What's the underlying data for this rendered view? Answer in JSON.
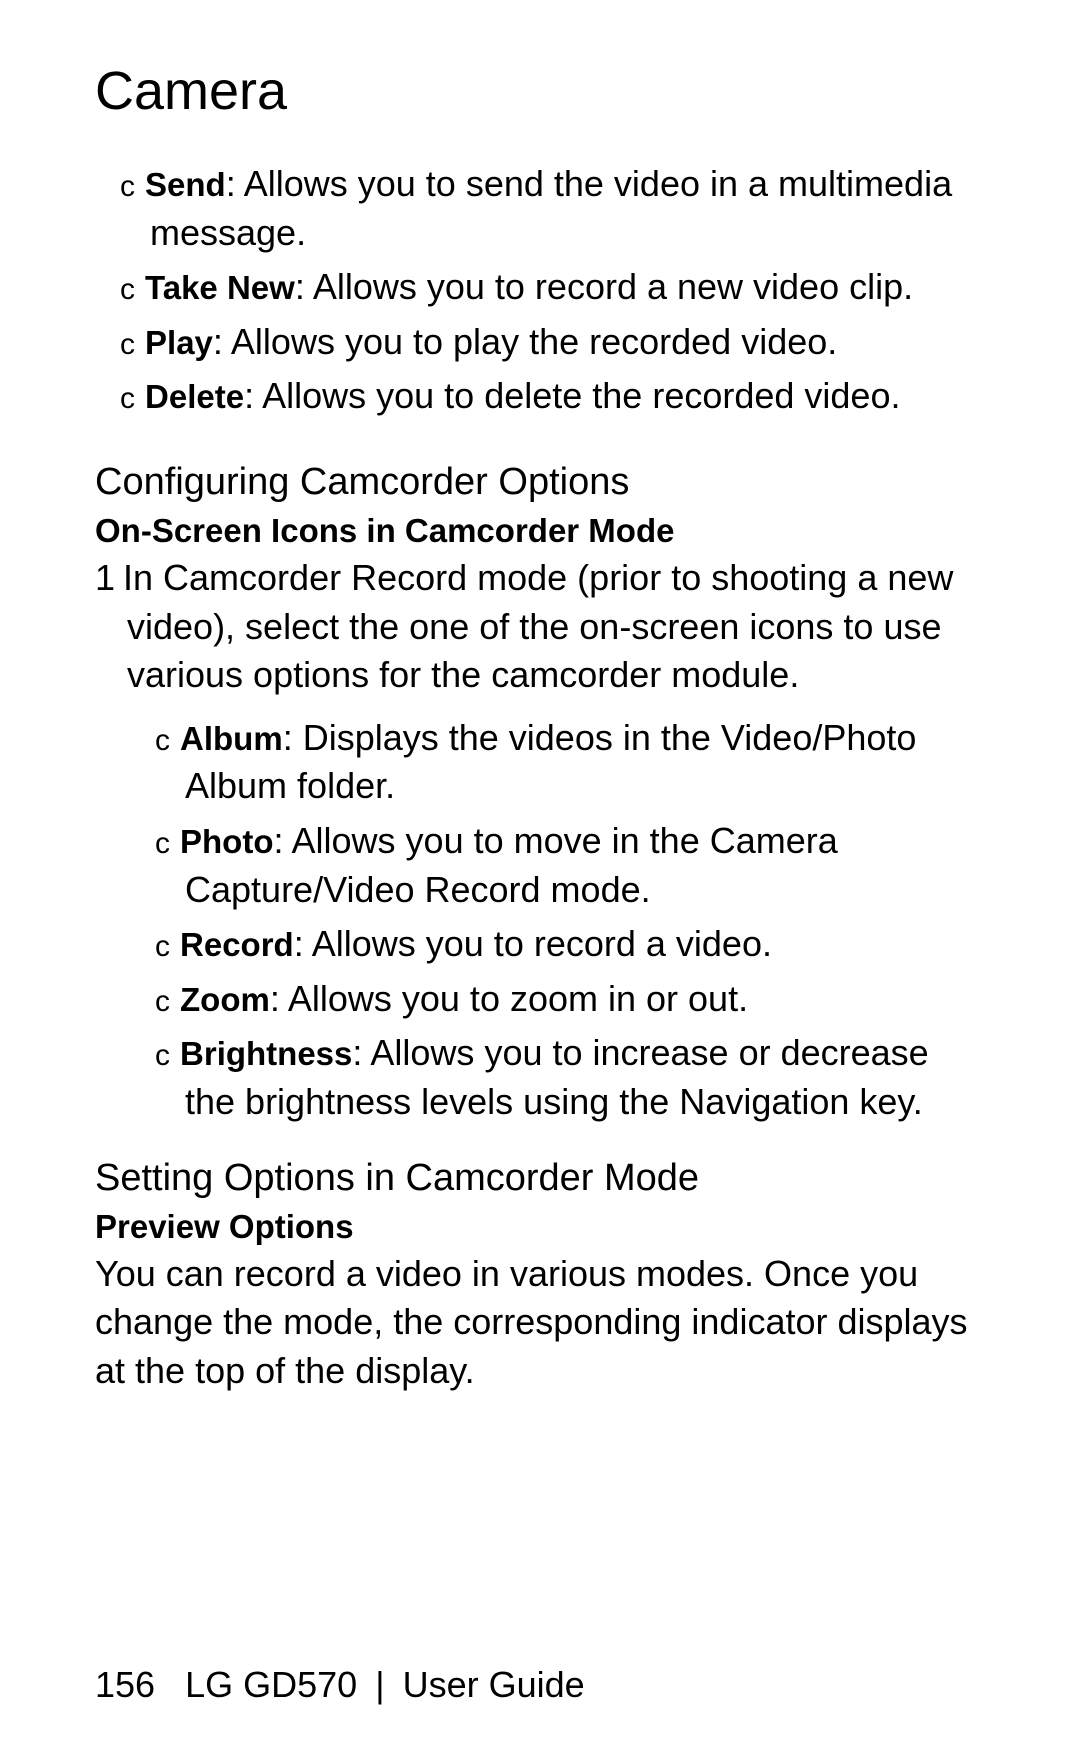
{
  "title": "Camera",
  "topBullets": [
    {
      "term": "Send",
      "desc": ": Allows you to send the video in a multimedia message."
    },
    {
      "term": "Take New",
      "desc": ": Allows you to record a new video clip."
    },
    {
      "term": "Play",
      "desc": ": Allows you to play the recorded video."
    },
    {
      "term": "Delete",
      "desc": ": Allows you to delete the recorded video."
    }
  ],
  "section1": {
    "heading": "Conﬁguring Camcorder Options",
    "subheading": "On-Screen Icons in Camcorder Mode",
    "numbered": {
      "num": "1",
      "text": "In Camcorder Record mode (prior to shooting a new video), select the one of the on-screen icons to use various options for the camcorder module."
    },
    "nested": [
      {
        "term": "Album",
        "desc": ": Displays the videos in the Video/Photo Album folder."
      },
      {
        "term": "Photo",
        "desc": ": Allows you to move in the Camera Capture/Video Record mode."
      },
      {
        "term": "Record",
        "desc": ": Allows you to record a video."
      },
      {
        "term": "Zoom",
        "desc": ": Allows you to zoom in or out."
      },
      {
        "term": "Brightness",
        "desc": ": Allows you to increase or decrease the brightness levels using the Navigation key."
      }
    ]
  },
  "section2": {
    "heading": "Setting Options in Camcorder Mode",
    "subheading": "Preview Options",
    "para": "You can record a video in various modes. Once you change the mode, the corresponding indicator displays at the top of the display."
  },
  "footer": {
    "page": "156",
    "product": "LG GD570",
    "sep": "|",
    "label": "User Guide"
  },
  "bulletMarker": "c"
}
